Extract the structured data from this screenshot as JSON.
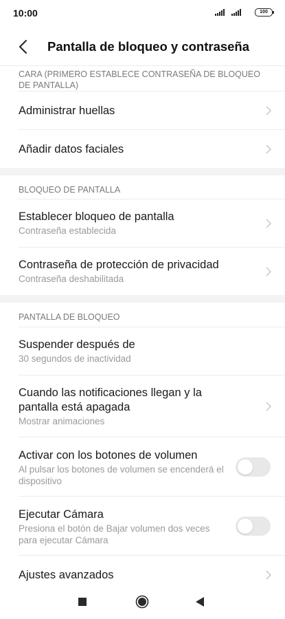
{
  "status_bar": {
    "time": "10:00",
    "battery": "100"
  },
  "header": {
    "title": "Pantalla de bloqueo y contraseña"
  },
  "sections": {
    "face": {
      "label": "CARA (PRIMERO ESTABLECE CONTRASEÑA DE BLOQUEO DE PANTALLA)",
      "items": [
        {
          "title": "Administrar huellas"
        },
        {
          "title": "Añadir datos faciales"
        }
      ]
    },
    "screen_lock": {
      "label": "BLOQUEO DE PANTALLA",
      "items": [
        {
          "title": "Establecer bloqueo de pantalla",
          "subtitle": "Contraseña establecida"
        },
        {
          "title": "Contraseña de protección de privacidad",
          "subtitle": "Contraseña deshabilitada"
        }
      ]
    },
    "lock_screen": {
      "label": "PANTALLA DE BLOQUEO",
      "items": [
        {
          "title": "Suspender después de",
          "subtitle": "30 segundos de inactividad"
        },
        {
          "title": "Cuando las notificaciones llegan y la pantalla está apagada",
          "subtitle": "Mostrar animaciones"
        },
        {
          "title": "Activar con los botones de volumen",
          "subtitle": "Al pulsar los botones de volumen se encenderá el dispositivo",
          "toggle_on": false
        },
        {
          "title": "Ejecutar Cámara",
          "subtitle": "Presiona el botón de Bajar volumen dos veces para ejecutar Cámara",
          "toggle_on": false
        },
        {
          "title": "Ajustes avanzados"
        }
      ]
    }
  },
  "nav_bar": {
    "icons": [
      "recents-icon",
      "home-icon",
      "back-icon"
    ]
  }
}
